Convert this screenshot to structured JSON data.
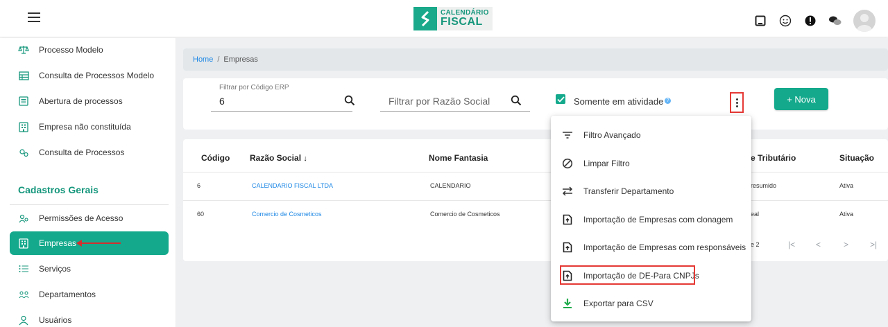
{
  "header": {
    "logo_line1": "CALENDÁRIO",
    "logo_line2": "FISCAL",
    "icons": [
      "menu-icon",
      "tablet-icon",
      "smiley-icon",
      "alert-icon",
      "chat-icon",
      "user-avatar"
    ]
  },
  "sidebar": {
    "items": [
      {
        "label": "Processo Modelo",
        "icon": "balance-icon"
      },
      {
        "label": "Consulta de Processos Modelo",
        "icon": "table-icon"
      },
      {
        "label": "Abertura de processos",
        "icon": "list-icon"
      },
      {
        "label": "Empresa não constituída",
        "icon": "building-icon"
      },
      {
        "label": "Consulta de Processos",
        "icon": "gears-icon"
      }
    ],
    "section_title": "Cadastros Gerais",
    "section_items": [
      {
        "label": "Permissões de Acesso",
        "icon": "users-icon"
      },
      {
        "label": "Empresas",
        "icon": "building-icon"
      },
      {
        "label": "Serviços",
        "icon": "list-bullets-icon"
      },
      {
        "label": "Departamentos",
        "icon": "group-icon"
      },
      {
        "label": "Usuários",
        "icon": "user-icon"
      }
    ]
  },
  "breadcrumb": {
    "home": "Home",
    "sep": "/",
    "current": "Empresas"
  },
  "filters": {
    "erp_label": "Filtrar por Código ERP",
    "erp_value": "6",
    "razao_placeholder": "Filtrar por Razão Social",
    "ativo_label": "Somente em atividade",
    "ativo_help": "?",
    "nova_label": "+ Nova"
  },
  "table": {
    "headers": {
      "codigo": "Código",
      "razao": "Razão Social",
      "razao_sort": "↓",
      "fantasia": "Nome Fantasia",
      "tributario": "e Tributário",
      "situacao": "Situação"
    },
    "rows": [
      {
        "codigo": "6",
        "razao": "CALENDARIO FISCAL LTDA",
        "fantasia": "CALENDARIO",
        "tributario": "resumido",
        "situacao": "Ativa"
      },
      {
        "codigo": "60",
        "razao": "Comercio de Cosmeticos",
        "fantasia": "Comercio de Cosmeticos",
        "tributario": "eal",
        "situacao": "Ativa"
      }
    ],
    "pager_text": "e 2",
    "pager_buttons": [
      "|<",
      "<",
      ">",
      ">|"
    ]
  },
  "menu": {
    "items": [
      {
        "label": "Filtro Avançado",
        "icon": "filter-icon"
      },
      {
        "label": "Limpar Filtro",
        "icon": "clear-icon"
      },
      {
        "label": "Transferir Departamento",
        "icon": "transfer-icon"
      },
      {
        "label": "Importação de Empresas com clonagem",
        "icon": "upload-file-icon"
      },
      {
        "label": "Importação de Empresas com responsáveis",
        "icon": "upload-file-icon"
      },
      {
        "label": "Importação de DE-Para CNPJs",
        "icon": "upload-file-icon"
      },
      {
        "label": "Exportar para CSV",
        "icon": "download-icon"
      }
    ]
  },
  "colors": {
    "brand": "#14a98c",
    "link": "#1e88e5",
    "highlight": "#e53935"
  }
}
